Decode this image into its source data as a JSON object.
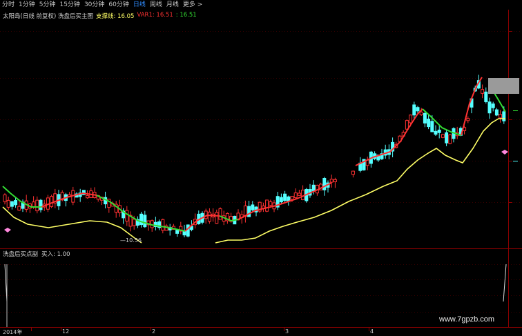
{
  "toolbar": {
    "items": [
      "分时",
      "1分钟",
      "5分钟",
      "15分钟",
      "30分钟",
      "60分钟",
      "日线",
      "周线",
      "月线",
      "更多 >"
    ],
    "active_index": 6
  },
  "main_legend": {
    "title": "太阳岛(日线 前复权) 洗盘后买主图",
    "support_label": "支撑线: 16.05",
    "var1_label": "VAR1: 16.51",
    "var2_label": ": 16.51"
  },
  "sub_legend": {
    "title": "洗盘后买点副",
    "buy_label": "买入: 1.00"
  },
  "price_label": "—10.56",
  "dates": [
    "2014年",
    "12",
    "2",
    "3",
    "4"
  ],
  "watermark": "www.7gpzb.com",
  "colors": {
    "up": "#ff3232",
    "down": "#54ffff",
    "support": "#ffff66",
    "var1_red": "#ff3232",
    "var1_green": "#33dd33",
    "active_tab": "#2f8cff"
  }
}
